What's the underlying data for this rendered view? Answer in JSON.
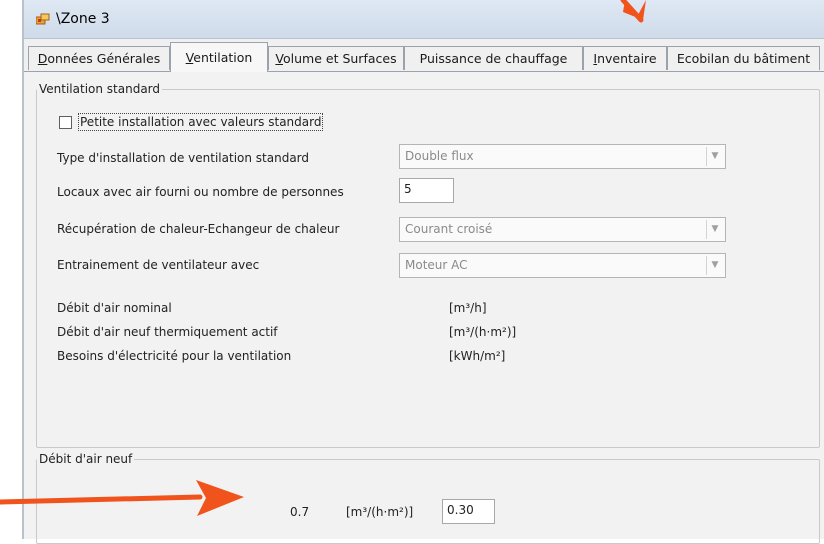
{
  "window": {
    "title": "\\Zone 3"
  },
  "tabs": [
    {
      "label": "Données Générales",
      "mnemonic": "D",
      "rest": "onnées Générales"
    },
    {
      "label": "Ventilation",
      "mnemonic": "V",
      "rest": "entilation"
    },
    {
      "label": "Volume et Surfaces",
      "mnemonic": "V",
      "rest": "olume et Surfaces"
    },
    {
      "label": "Puissance de chauffage",
      "mnemonic": "",
      "rest": "Puissance de chauffage"
    },
    {
      "label": "Inventaire",
      "mnemonic": "I",
      "rest": "nventaire"
    },
    {
      "label": "Ecobilan du bâtiment",
      "mnemonic": "",
      "rest": "Ecobilan du bâtiment"
    }
  ],
  "active_tab": "Ventilation",
  "ventilation_standard": {
    "legend": "Ventilation standard",
    "checkbox": {
      "label": "Petite installation avec valeurs standard",
      "checked": false
    },
    "type_installation": {
      "label": "Type d'installation de ventilation standard",
      "value": "Double flux"
    },
    "locaux": {
      "label": "Locaux avec air fourni ou nombre de personnes",
      "value": "5"
    },
    "recuperation": {
      "label": "Récupération de chaleur-Echangeur de chaleur",
      "value": "Courant croisé"
    },
    "entrainement": {
      "label": "Entrainement de ventilateur avec",
      "value": "Moteur AC"
    },
    "results": [
      {
        "label": "Débit d'air nominal",
        "unit": "[m³/h]"
      },
      {
        "label": "Débit d'air neuf thermiquement actif",
        "unit": "[m³/(h·m²)]"
      },
      {
        "label": "Besoins d'électricité pour la ventilation",
        "unit": "[kWh/m²]"
      }
    ]
  },
  "debit_air_neuf": {
    "legend": "Débit d'air neuf",
    "computed_value": "0.7",
    "unit": "[m³/(h·m²)]",
    "input_value": "0.30"
  },
  "colors": {
    "annotation_arrow": "#f0531c",
    "window_bg": "#f0f0f0",
    "titlebar": "#d7e2f0"
  }
}
